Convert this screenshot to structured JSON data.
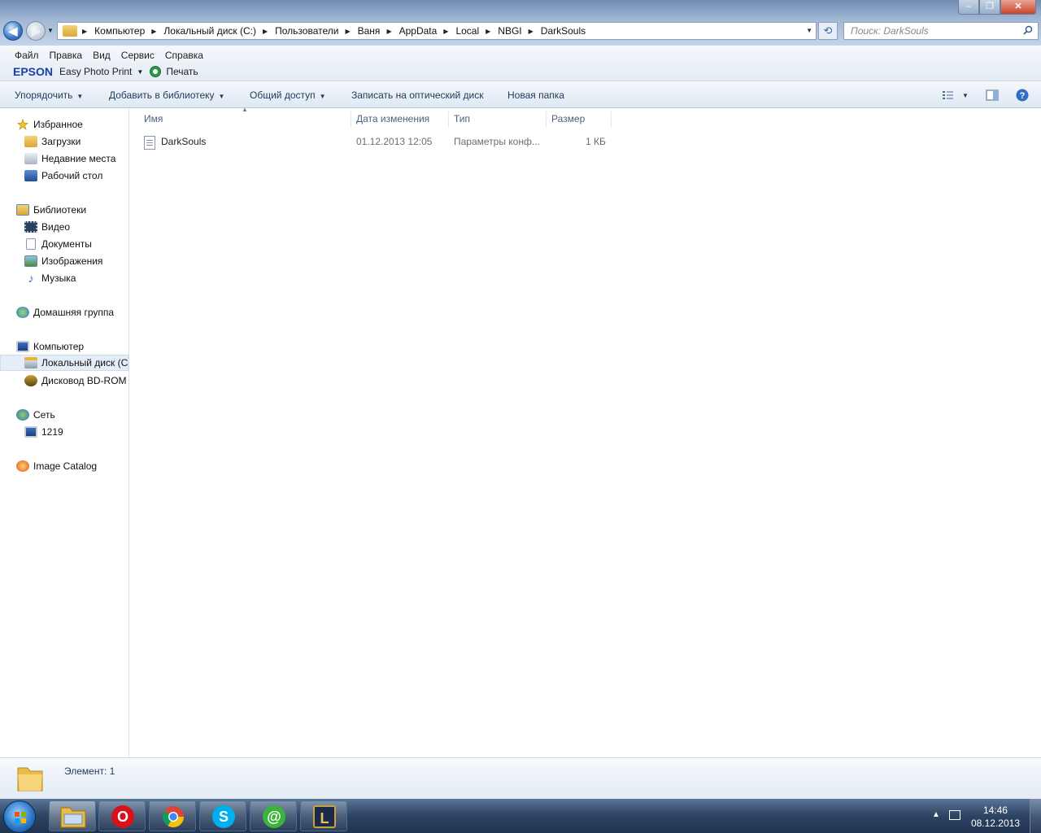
{
  "window": {
    "minimize_label": "–",
    "maximize_label": "❐",
    "close_label": "✕"
  },
  "address": {
    "back_label": "◀",
    "forward_label": "▶",
    "breadcrumb": [
      "Компьютер",
      "Локальный диск (C:)",
      "Пользователи",
      "Ваня",
      "AppData",
      "Local",
      "NBGI",
      "DarkSouls"
    ],
    "refresh_label": "⟲",
    "search_placeholder": "Поиск: DarkSouls"
  },
  "menubar": {
    "items": [
      "Файл",
      "Правка",
      "Вид",
      "Сервис",
      "Справка"
    ],
    "epson_logo": "EPSON",
    "epson_app": "Easy Photo Print",
    "print_label": "Печать"
  },
  "commandbar": {
    "organize": "Упорядочить",
    "add_to_library": "Добавить в библиотеку",
    "share": "Общий доступ",
    "burn": "Записать на оптический диск",
    "new_folder": "Новая папка"
  },
  "navpane": {
    "favorites": "Избранное",
    "downloads": "Загрузки",
    "recent": "Недавние места",
    "desktop": "Рабочий стол",
    "libraries": "Библиотеки",
    "video": "Видео",
    "documents": "Документы",
    "pictures": "Изображения",
    "music": "Музыка",
    "homegroup": "Домашняя группа",
    "computer": "Компьютер",
    "local_disk": "Локальный диск (C",
    "bdrom": "Дисковод BD-ROM",
    "network": "Сеть",
    "network_pc": "1219",
    "image_catalog": "Image Catalog"
  },
  "filelist": {
    "columns": {
      "name": "Имя",
      "date": "Дата изменения",
      "type": "Тип",
      "size": "Размер"
    },
    "rows": [
      {
        "name": "DarkSouls",
        "date": "01.12.2013 12:05",
        "type": "Параметры конф...",
        "size": "1 КБ"
      }
    ]
  },
  "statusbar": {
    "count": "Элемент: 1"
  },
  "taskbar": {
    "opera_glyph": "O",
    "skype_glyph": "S",
    "agent_glyph": "@",
    "lol_glyph": "L",
    "time": "14:46",
    "date": "08.12.2013"
  }
}
